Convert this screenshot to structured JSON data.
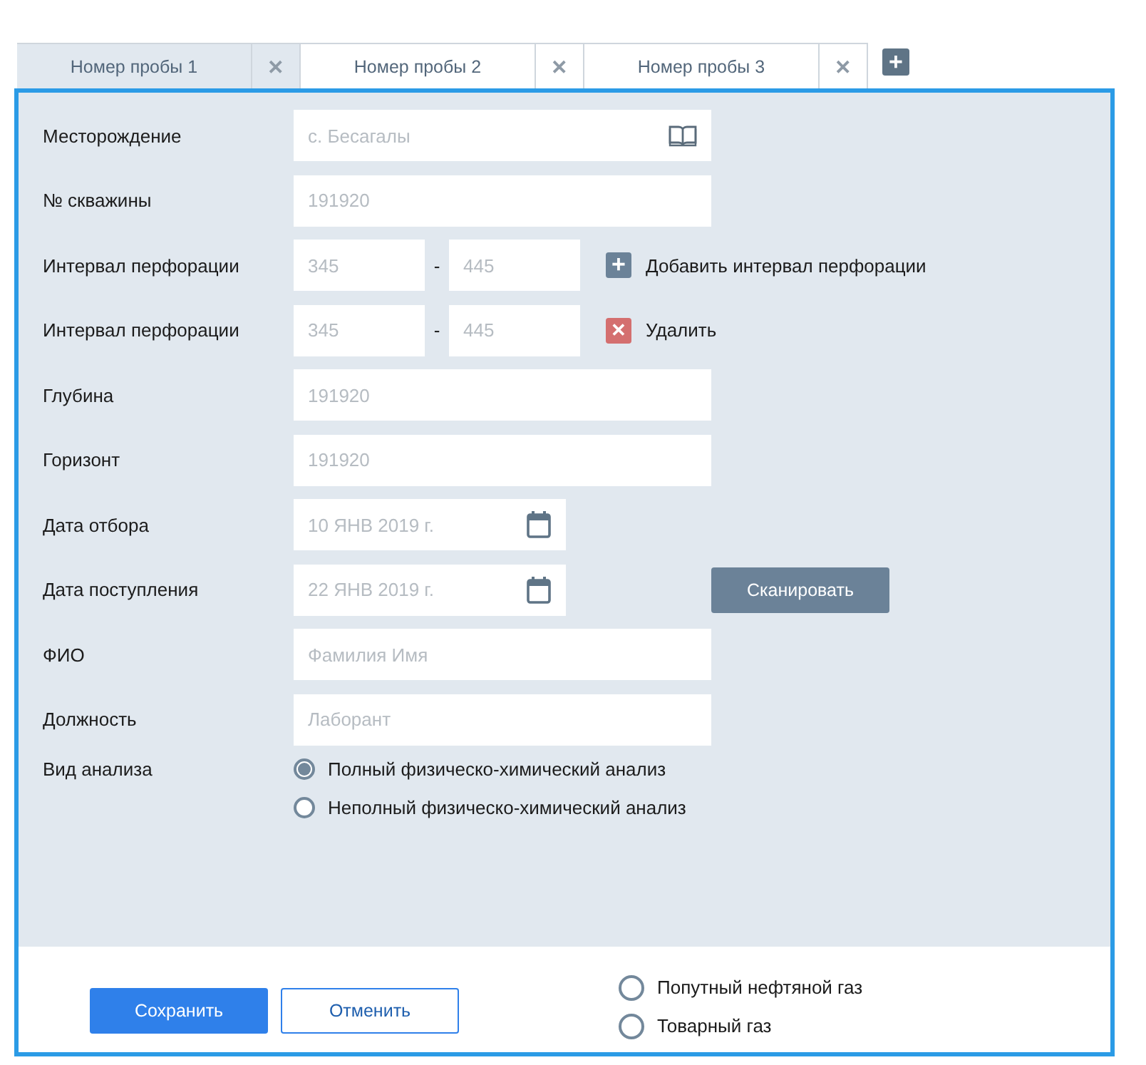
{
  "tabs": [
    {
      "label": "Номер пробы 1",
      "close": "✕",
      "selected": true
    },
    {
      "label": "Номер пробы 2",
      "close": "✕",
      "selected": false
    },
    {
      "label": "Номер пробы 3",
      "close": "✕",
      "selected": false
    }
  ],
  "add_tab": "+",
  "form": [
    {
      "kind": "lookup",
      "label": "Месторождение",
      "placeholder": "с. Бесагалы"
    },
    {
      "kind": "text",
      "label": "№ скважины",
      "placeholder": "191920"
    },
    {
      "kind": "range",
      "label": "Интервал перфорации",
      "from": "345",
      "separator": "-",
      "to": "445",
      "action": {
        "kind": "add",
        "symbol": "+",
        "label": "Добавить интервал перфорации"
      }
    },
    {
      "kind": "range",
      "label": "Интервал перфорации",
      "from": "345",
      "separator": "-",
      "to": "445",
      "action": {
        "kind": "remove",
        "symbol": "✕",
        "label": "Удалить"
      }
    },
    {
      "kind": "text",
      "label": "Глубина",
      "placeholder": "191920"
    },
    {
      "kind": "text",
      "label": "Горизонт",
      "placeholder": "191920"
    },
    {
      "kind": "date",
      "label": "Дата отбора",
      "placeholder": "10 ЯНВ 2019 г."
    },
    {
      "kind": "date",
      "label": "Дата поступления",
      "placeholder": "22 ЯНВ 2019 г.",
      "button": "Сканировать"
    },
    {
      "kind": "text",
      "label": "ФИО",
      "placeholder": "Фамилия Имя"
    },
    {
      "kind": "text",
      "label": "Должность",
      "placeholder": "Лаборант"
    },
    {
      "kind": "radio",
      "label": "Вид анализа",
      "options": [
        {
          "label": "Полный физическо-химический анализ",
          "selected": true
        },
        {
          "label": "Неполный физическо-химический анализ",
          "selected": false
        }
      ]
    }
  ],
  "footer": {
    "save": "Сохранить",
    "cancel": "Отменить",
    "gas_types": [
      {
        "label": "Попутный нефтяной газ",
        "selected": false
      },
      {
        "label": "Товарный газ",
        "selected": false
      }
    ]
  }
}
